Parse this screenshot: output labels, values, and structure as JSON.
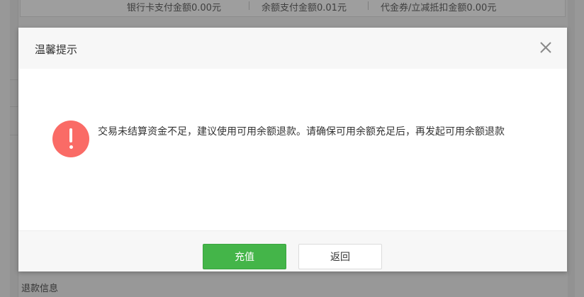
{
  "background": {
    "top_items": [
      "银行卡支付金额0.00元",
      "余额支付金额0.01元",
      "代金券/立减抵扣金额0.00元"
    ],
    "bottom_label": "退款信息"
  },
  "dialog": {
    "title": "温馨提示",
    "close_icon": "close-icon",
    "warning_icon": "exclamation-circle-icon",
    "message": "交易未结算资金不足，建议使用可用余额退款。请确保可用余额充足后，再发起可用余额退款",
    "primary_button": "充值",
    "secondary_button": "返回"
  },
  "colors": {
    "primary": "#44b549",
    "warning": "#fa6b66"
  }
}
